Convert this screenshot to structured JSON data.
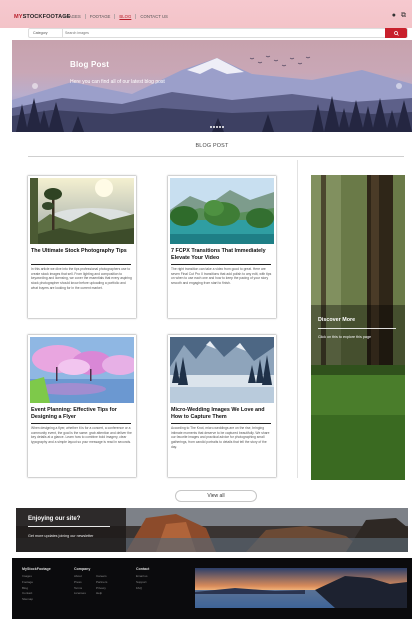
{
  "header": {
    "logo_prefix": "MY",
    "logo_rest": "STOCKFOOTAGE",
    "nav": [
      "IMAGES",
      "FOOTAGE",
      "BLOG",
      "CONTACT US"
    ],
    "active_nav": "BLOG",
    "icons": [
      "user-icon",
      "cart-icon"
    ]
  },
  "search": {
    "category": "Category",
    "placeholder": "Search images",
    "button_icon": "search-icon"
  },
  "hero": {
    "title": "Blog Post",
    "subtitle": "Here you can find all of our latest blog post",
    "slides": 5
  },
  "section": {
    "title": "BLOG POST"
  },
  "cards": [
    {
      "title": "The Ultimate Stock Photography Tips",
      "excerpt": "In this article we dive into the tips professional photographers use to create stock images that sell. From lighting and composition to keywording and licensing, we cover the essentials that every aspiring stock photographer should know before uploading a portfolio and what buyers are looking for in the current market."
    },
    {
      "title": "7 FCPX Transitions That Immediately Elevate Your Video",
      "excerpt": "The right transition can take a video from good to great. Here are seven Final Cut Pro X transitions that add polish to any edit, with tips on when to use each one and how to keep the pacing of your story smooth and engaging from start to finish."
    },
    {
      "title": "Event Planning: Effective Tips for Designing a Flyer",
      "excerpt": "When designing a flyer, whether it is for a concert, a conference or a community event, the goal is the same: grab attention and deliver the key details at a glance. Learn how to combine bold imagery, clear typography and a simple layout so your message is read in seconds."
    },
    {
      "title": "Micro-Wedding Images We Love and How to Capture Them",
      "excerpt": "According to The Knot, micro-weddings are on the rise, bringing intimate moments that deserve to be captured beautifully. We share our favorite images and practical advice for photographing small gatherings, from candid portraits to details that tell the story of the day."
    }
  ],
  "sidebar": {
    "title": "Discover More",
    "text": "Click on this to explore this page"
  },
  "view_all": "View all",
  "banner": {
    "title": "Enjoying our site?",
    "text": "Get more updates joining our newsletter"
  },
  "footer": {
    "col1": {
      "heading": "MyStockFootage",
      "links": [
        "Images",
        "Footage",
        "Blog",
        "Contact",
        "Sitemap"
      ]
    },
    "col2": {
      "heading": "Company",
      "links": [
        "About",
        "Careers",
        "Press",
        "Partners",
        "Terms",
        "Privacy",
        "Licenses",
        "Help"
      ]
    },
    "col3": {
      "heading": "Contact",
      "links": [
        "Email us",
        "Support",
        "FAQ"
      ]
    }
  }
}
